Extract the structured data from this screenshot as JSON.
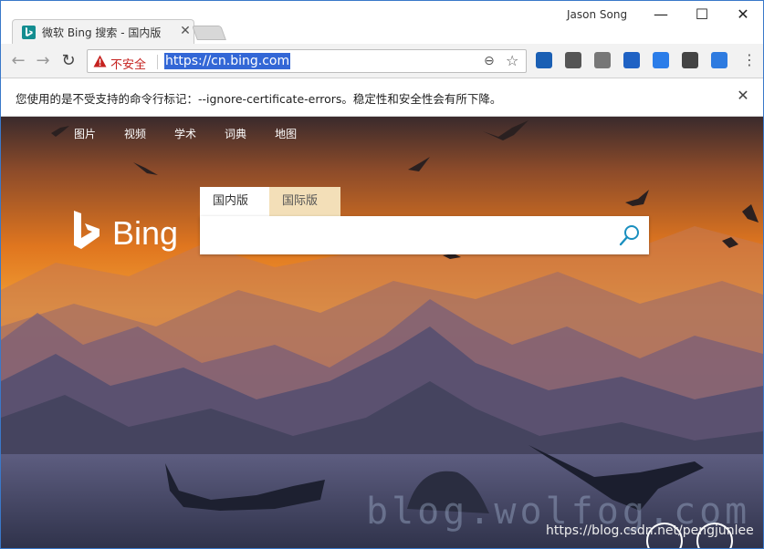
{
  "window": {
    "user_name": "Jason Song",
    "minimize_glyph": "—",
    "maximize_glyph": "☐",
    "close_glyph": "✕"
  },
  "tab": {
    "title": "微软 Bing 搜索 - 国内版",
    "close_glyph": "✕",
    "favicon": "bing-favicon"
  },
  "toolbar": {
    "back_glyph": "←",
    "forward_glyph": "→",
    "reload_glyph": "↻",
    "security_label": "不安全",
    "url": "https://cn.bing.com",
    "zoom_glyph": "⊖",
    "star_glyph": "☆",
    "menu_glyph": "⋮",
    "extensions": [
      {
        "name": "vuejs-icon",
        "color": "#1a5fb4"
      },
      {
        "name": "qr-code-icon",
        "color": "#555555"
      },
      {
        "name": "layers-icon",
        "color": "#777777"
      },
      {
        "name": "translate-icon",
        "color": "#1f62c4"
      },
      {
        "name": "edit-icon",
        "color": "#2b7de9"
      },
      {
        "name": "dictionary-icon",
        "color": "#444444"
      },
      {
        "name": "reader-icon",
        "color": "#2e7be0"
      }
    ]
  },
  "infobar": {
    "message": "您使用的是不受支持的命令行标记：--ignore-certificate-errors。稳定性和安全性会有所下降。",
    "close_glyph": "✕"
  },
  "bing": {
    "nav": [
      "图片",
      "视频",
      "学术",
      "词典",
      "地图"
    ],
    "logo_text": "Bing",
    "tabs": [
      "国内版",
      "国际版"
    ],
    "search_value": "",
    "search_placeholder": ""
  },
  "watermark": {
    "text": "https://blog.csdn.net/pengjunlee",
    "big_text": "blog.wolfog.com"
  }
}
